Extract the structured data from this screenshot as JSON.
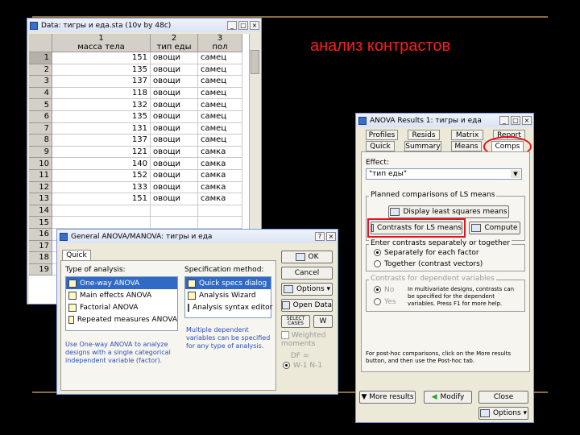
{
  "heading": "анализ контрастов",
  "data_window": {
    "title": "Data: тигры и еда.sta (10v by 48c)",
    "columns": [
      {
        "num": "1",
        "name": "масса тела"
      },
      {
        "num": "2",
        "name": "тип еды"
      },
      {
        "num": "3",
        "name": "пол"
      }
    ],
    "rows": [
      {
        "n": "1",
        "mass": "151",
        "food": "овощи",
        "sex": "самец"
      },
      {
        "n": "2",
        "mass": "135",
        "food": "овощи",
        "sex": "самец"
      },
      {
        "n": "3",
        "mass": "137",
        "food": "овощи",
        "sex": "самец"
      },
      {
        "n": "4",
        "mass": "118",
        "food": "овощи",
        "sex": "самец"
      },
      {
        "n": "5",
        "mass": "132",
        "food": "овощи",
        "sex": "самец"
      },
      {
        "n": "6",
        "mass": "135",
        "food": "овощи",
        "sex": "самец"
      },
      {
        "n": "7",
        "mass": "131",
        "food": "овощи",
        "sex": "самец"
      },
      {
        "n": "8",
        "mass": "137",
        "food": "овощи",
        "sex": "самец"
      },
      {
        "n": "9",
        "mass": "121",
        "food": "овощи",
        "sex": "самка"
      },
      {
        "n": "10",
        "mass": "140",
        "food": "овощи",
        "sex": "самка"
      },
      {
        "n": "11",
        "mass": "152",
        "food": "овощи",
        "sex": "самка"
      },
      {
        "n": "12",
        "mass": "133",
        "food": "овощи",
        "sex": "самка"
      },
      {
        "n": "13",
        "mass": "151",
        "food": "овощи",
        "sex": "самка"
      },
      {
        "n": "14",
        "mass": "",
        "food": "",
        "sex": ""
      },
      {
        "n": "15",
        "mass": "",
        "food": "",
        "sex": ""
      },
      {
        "n": "16",
        "mass": "",
        "food": "",
        "sex": ""
      },
      {
        "n": "17",
        "mass": "",
        "food": "",
        "sex": ""
      },
      {
        "n": "18",
        "mass": "",
        "food": "",
        "sex": ""
      },
      {
        "n": "19",
        "mass": "",
        "food": "",
        "sex": ""
      }
    ]
  },
  "general_anova": {
    "title": "General ANOVA/MANOVA: тигры и еда",
    "tab": "Quick",
    "type_label": "Type of analysis:",
    "types": [
      "One-way ANOVA",
      "Main effects ANOVA",
      "Factorial ANOVA",
      "Repeated measures ANOVA"
    ],
    "spec_label": "Specification method:",
    "methods": [
      "Quick specs dialog",
      "Analysis Wizard",
      "Analysis syntax editor"
    ],
    "note_left": "Use One-way ANOVA to analyze designs with a single categorical independent variable (factor).",
    "note_right": "Multiple dependent variables can be specified for any type of analysis.",
    "ok": "OK",
    "cancel": "Cancel",
    "options": "Options",
    "open_data": "Open Data",
    "select_cases": "SELECT CASES",
    "weighted": "Weighted moments",
    "df_label": "DF =",
    "df_value": "W-1  N-1"
  },
  "results": {
    "title": "ANOVA Results 1: тигры и еда",
    "tabs_row1": [
      "Profiles",
      "Resids",
      "Matrix",
      "Report"
    ],
    "tabs_row2": [
      "Quick",
      "Summary",
      "Means",
      "Comps"
    ],
    "effect_label": "Effect:",
    "effect_value": "\"тип еды\"",
    "planned_label": "Planned comparisons of LS means",
    "display_ls": "Display least squares means",
    "contrasts_btn": "Contrasts for LS means",
    "compute": "Compute",
    "enter_label": "Enter contrasts separately or together",
    "separately": "Separately for each factor",
    "together": "Together (contrast vectors)",
    "dep_label": "Contrasts for dependent variables",
    "no": "No",
    "yes": "Yes",
    "dep_note": "In multivariate designs, contrasts can be specified for the dependent variables. Press F1 for more help.",
    "posthoc_note": "For post-hoc comparisons, click on the More results button, and then use the Post-hoc tab.",
    "more_results": "More results",
    "modify": "Modify",
    "close": "Close",
    "options": "Options"
  },
  "colors": {
    "highlight": "#316ac5",
    "annotation": "#e8121b",
    "heading": "#ff1c1c"
  }
}
